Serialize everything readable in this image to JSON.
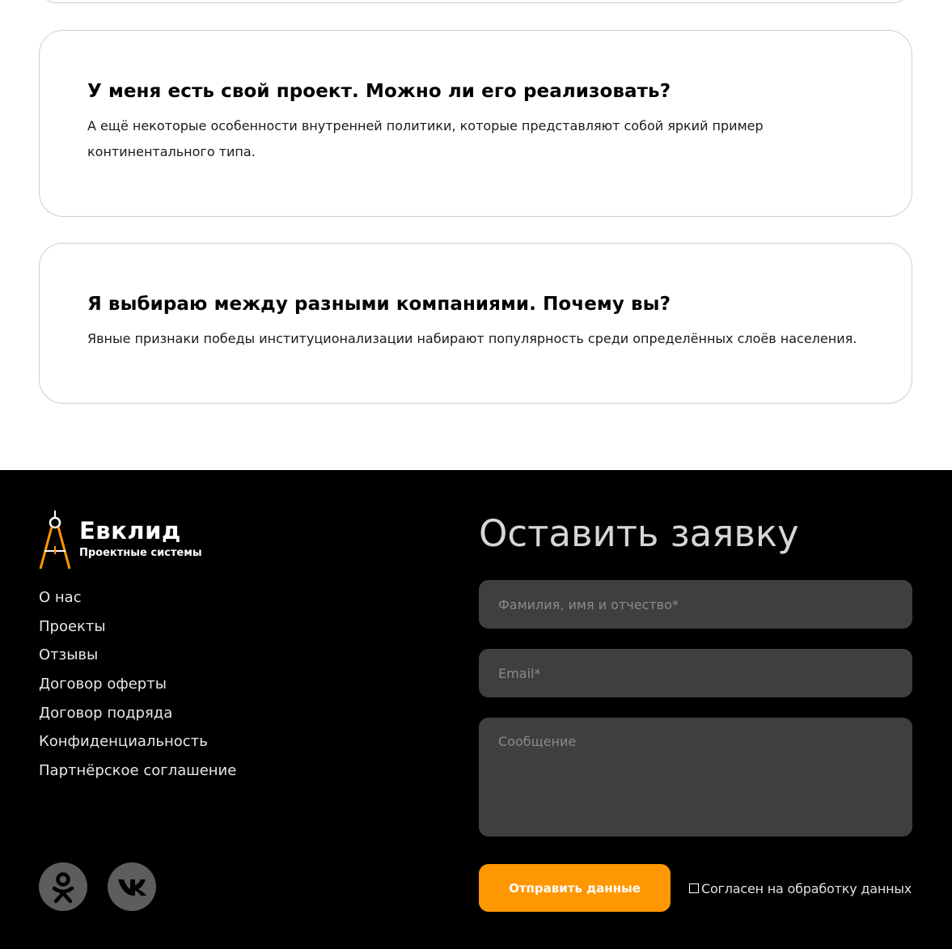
{
  "faq": {
    "items": [
      {
        "question": "У меня есть свой проект. Можно ли его реализовать?",
        "answer": "А ещё некоторые особенности внутренней политики, которые представляют собой яркий пример континентального типа."
      },
      {
        "question": "Я выбираю между разными компаниями. Почему вы?",
        "answer": "Явные признаки победы институционализации набирают популярность среди определённых слоёв населения."
      }
    ]
  },
  "footer": {
    "logo": {
      "name": "Евклид",
      "subtitle": "Проектные системы"
    },
    "nav": [
      "О нас",
      "Проекты",
      "Отзывы",
      "Договор оферты",
      "Договор подряда",
      "Конфиденциальность",
      "Партнёрское соглашение"
    ],
    "social": [
      {
        "icon": "odnoklassniki-icon"
      },
      {
        "icon": "vk-icon"
      }
    ]
  },
  "form": {
    "title": "Оставить заявку",
    "name_placeholder": "Фамилия, имя и отчество*",
    "email_placeholder": "Email*",
    "message_placeholder": "Сообщение",
    "submit_label": "Отправить данные",
    "consent_label": "Согласен на обработку данных"
  },
  "colors": {
    "accent": "#ff9800",
    "footer_bg": "#000000",
    "field_bg": "#3f3f3f",
    "social_bg": "#5d5d5d"
  }
}
